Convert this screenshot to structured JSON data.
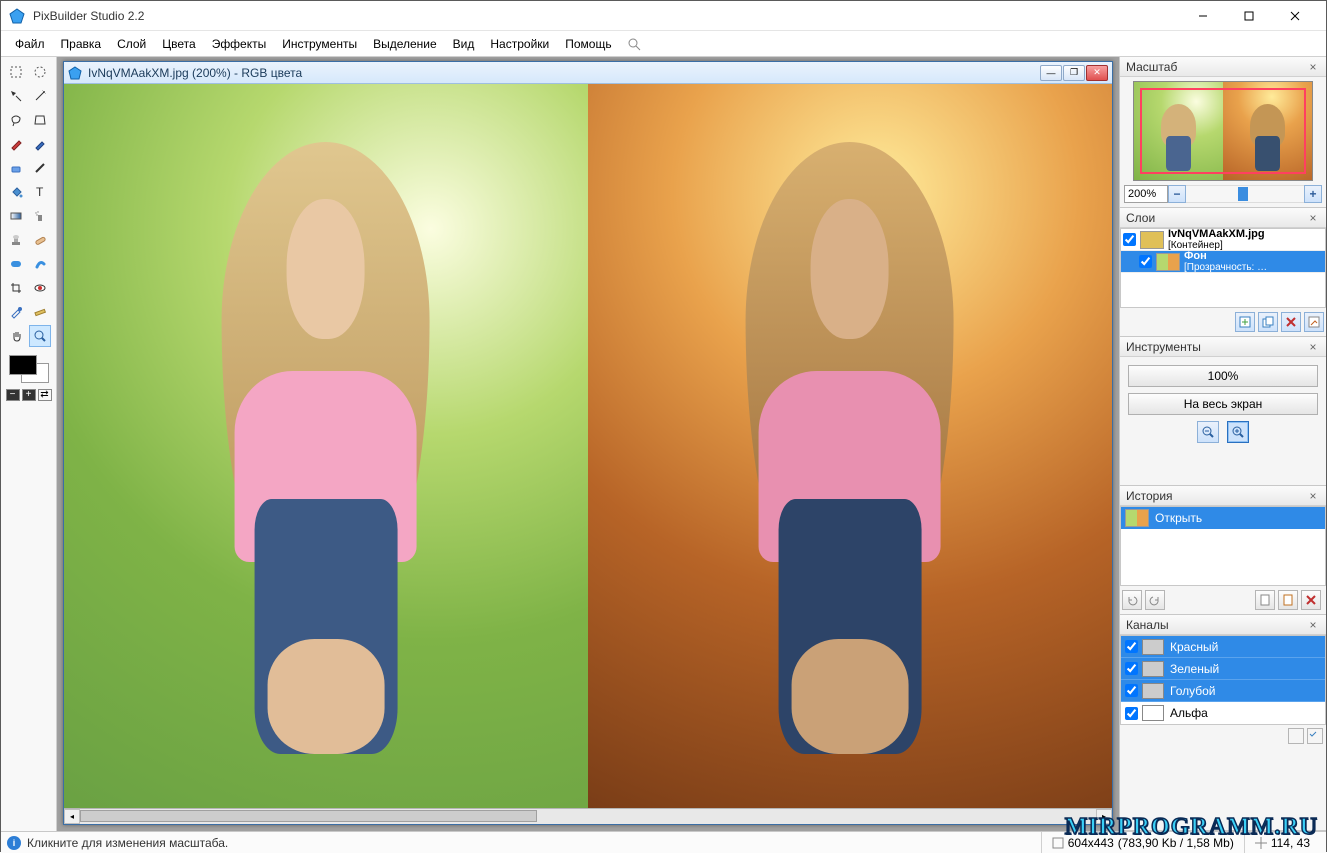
{
  "app": {
    "title": "PixBuilder Studio 2.2"
  },
  "menu": [
    "Файл",
    "Правка",
    "Слой",
    "Цвета",
    "Эффекты",
    "Инструменты",
    "Выделение",
    "Вид",
    "Настройки",
    "Помощь"
  ],
  "doc": {
    "caption": "IvNqVMAakXM.jpg (200%) - RGB цвета"
  },
  "panels": {
    "nav": {
      "title": "Масштаб",
      "zoom": "200%"
    },
    "layers": {
      "title": "Слои",
      "items": [
        {
          "name": "IvNqVMAakXM.jpg",
          "sub": "[Контейнер]",
          "selected": false
        },
        {
          "name": "Фон",
          "sub": "[Прозрачность: …",
          "selected": true
        }
      ]
    },
    "tools": {
      "title": "Инструменты",
      "btn1": "100%",
      "btn2": "На весь экран"
    },
    "history": {
      "title": "История",
      "items": [
        {
          "label": "Открыть",
          "selected": true
        }
      ]
    },
    "channels": {
      "title": "Каналы",
      "items": [
        "Красный",
        "Зеленый",
        "Голубой",
        "Альфа"
      ]
    }
  },
  "status": {
    "hint": "Кликните для изменения масштаба.",
    "dims": "604x443",
    "size": "(783,90 Kb / 1,58 Mb)",
    "pos": "114, 43"
  },
  "watermark": "MIRPROGRAMM.RU"
}
